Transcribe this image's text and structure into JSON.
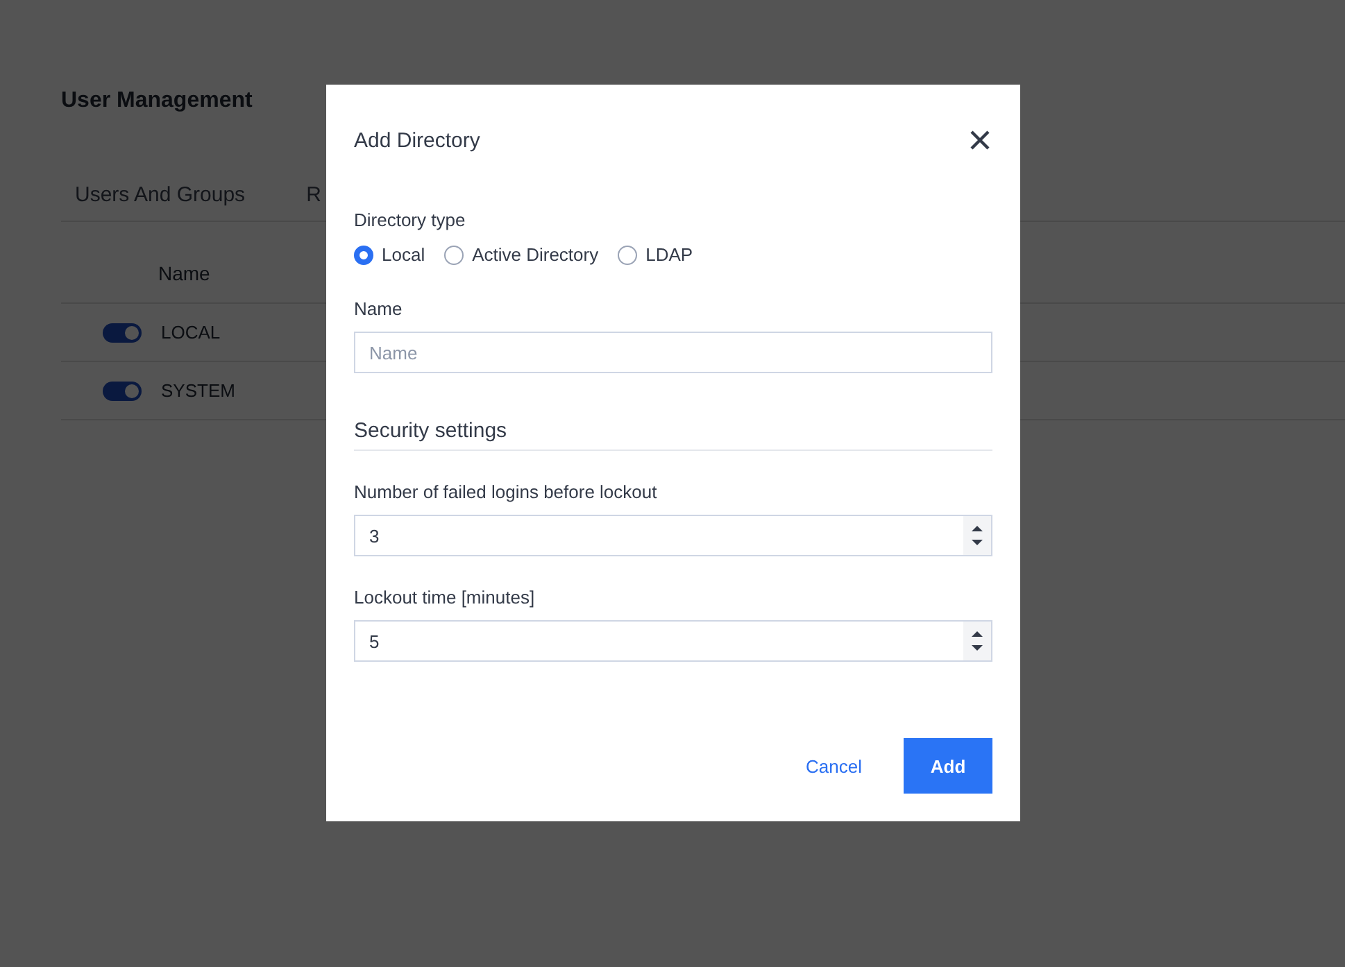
{
  "page": {
    "title": "User Management",
    "tabs": [
      {
        "label": "Users And Groups",
        "selected": false
      },
      {
        "label": "R",
        "selected": false
      }
    ],
    "table": {
      "columns": [
        "Name"
      ],
      "rows": [
        {
          "enabled": true,
          "name": "LOCAL"
        },
        {
          "enabled": true,
          "name": "SYSTEM"
        }
      ]
    }
  },
  "dialog": {
    "title": "Add Directory",
    "directory_type": {
      "label": "Directory type",
      "options": [
        {
          "label": "Local",
          "selected": true
        },
        {
          "label": "Active Directory",
          "selected": false
        },
        {
          "label": "LDAP",
          "selected": false
        }
      ]
    },
    "name": {
      "label": "Name",
      "placeholder": "Name"
    },
    "section": "Security settings",
    "number_fields": [
      {
        "label": "Number of failed logins before lockout",
        "value": "3"
      },
      {
        "label": "Lockout time [minutes]",
        "value": "5"
      }
    ],
    "buttons": [
      {
        "label": "Cancel",
        "kind": "link"
      },
      {
        "label": "Add",
        "kind": "primary"
      }
    ]
  }
}
